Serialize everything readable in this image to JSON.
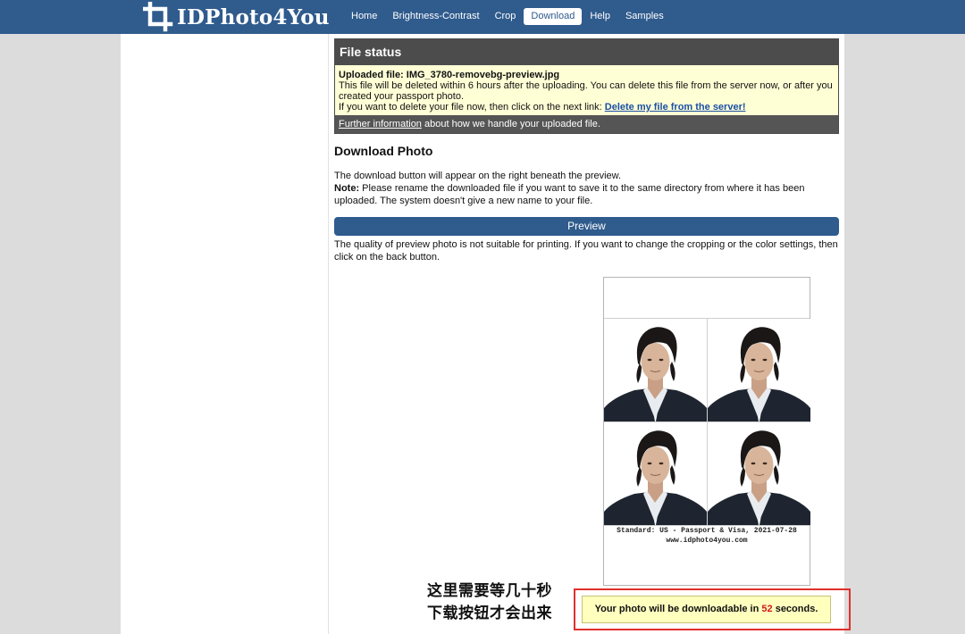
{
  "app": {
    "logo_text": "IDPhoto4You"
  },
  "nav": {
    "items": [
      "Home",
      "Brightness-Contrast",
      "Crop",
      "Download",
      "Help",
      "Samples"
    ],
    "active": "Download"
  },
  "file_status": {
    "title": "File status",
    "uploaded_label": "Uploaded file: IMG_3780-removebg-preview.jpg",
    "line1": "This file will be deleted within 6 hours after the uploading. You can delete this file from the server now, or after you created your passport photo.",
    "line2": "If you want to delete your file now, then click on the next link: ",
    "delete_link": "Delete my file from the server!",
    "further_link": "Further information",
    "further_text": " about how we handle your uploaded file."
  },
  "download": {
    "title": "Download Photo",
    "text1": "The download button will appear on the right beneath the preview.",
    "note_label": "Note:",
    "note_text": " Please rename the downloaded file if you want to save it to the same directory from where it has been uploaded. The system doesn't give a new name to your file."
  },
  "preview": {
    "bar_label": "Preview",
    "text": "The quality of preview photo is not suitable for printing. If you want to change the cropping or the color settings, then click on the back button."
  },
  "sheet": {
    "caption_line1": "Standard: US - Passport & Visa, 2021-07-28",
    "caption_line2": "www.idphoto4you.com",
    "photo_count": 4
  },
  "annotation": {
    "line1": "这里需要等几十秒",
    "line2": "下载按钮才会出来"
  },
  "notice": {
    "prefix": "Your photo will be downloadable in ",
    "seconds": "52",
    "suffix": " seconds."
  },
  "colors": {
    "brand": "#2f5b8d",
    "status_header": "#4c4c4c",
    "status_body": "#ffffd6",
    "highlight_box": "#e0302c",
    "countdown": "#d21b1b"
  }
}
